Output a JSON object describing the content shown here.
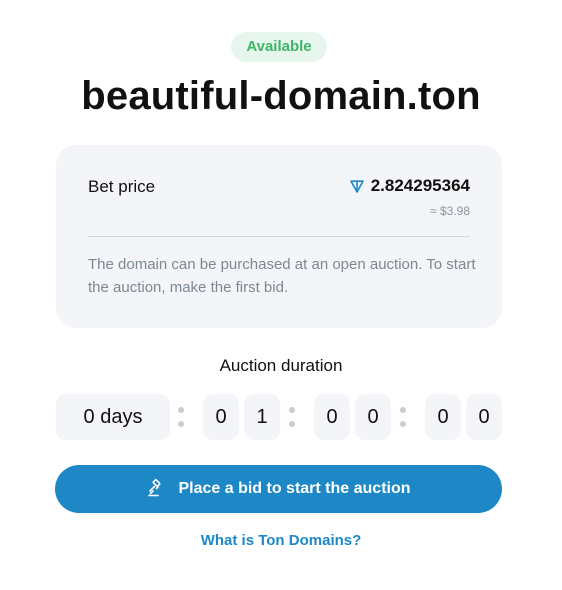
{
  "status_badge": "Available",
  "domain_name": "beautiful-domain.ton",
  "bet": {
    "label": "Bet price",
    "value": "2.824295364",
    "currency_icon": "ton-icon",
    "usd": "≈ $3.98"
  },
  "description": "The domain can be purchased at an open auction. To start the auction, make the first bid.",
  "auction": {
    "label": "Auction duration",
    "days": "0 days",
    "digits": [
      "0",
      "1",
      "0",
      "0",
      "0",
      "0"
    ]
  },
  "cta": {
    "label": "Place a bid to start the auction",
    "icon": "gavel-icon"
  },
  "link_label": "What is Ton Domains?",
  "colors": {
    "accent": "#1e88c7",
    "badge_text": "#3fb56a",
    "badge_bg": "#e7f6ec",
    "card_bg": "#f3f5f8"
  }
}
